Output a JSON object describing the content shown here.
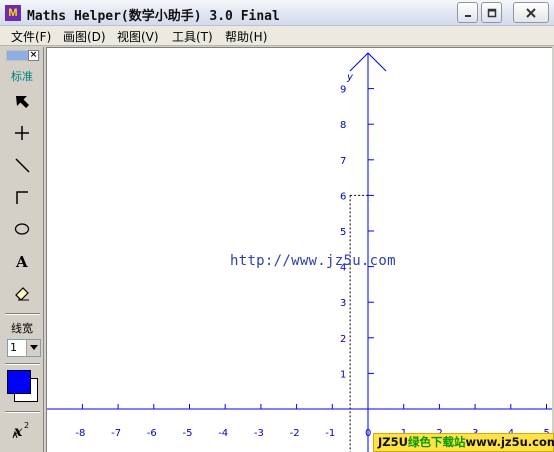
{
  "window": {
    "title": "Maths Helper(数学小助手) 3.0 Final",
    "icon_text": "M",
    "accent_color": "#6a2bb5"
  },
  "menu": {
    "items": [
      {
        "label": "文件(F)"
      },
      {
        "label": "画图(D)"
      },
      {
        "label": "视图(V)"
      },
      {
        "label": "工具(T)"
      },
      {
        "label": "帮助(H)"
      }
    ]
  },
  "toolbar": {
    "mode_label": "标准",
    "tools": [
      {
        "name": "select-arrow-icon"
      },
      {
        "name": "crosshair-point-icon"
      },
      {
        "name": "line-tool-icon"
      },
      {
        "name": "right-angle-icon"
      },
      {
        "name": "ellipse-tool-icon"
      },
      {
        "name": "text-tool-icon"
      },
      {
        "name": "eraser-icon"
      }
    ],
    "line_width_label": "线宽",
    "line_width_value": "1",
    "foreground_color": "#0000ff",
    "background_color": "#ffffff",
    "formula_icon": "function-x2-icon"
  },
  "graph": {
    "y_axis_label": "y",
    "x_ticks": [
      "-8",
      "-7",
      "-6",
      "-5",
      "-4",
      "-3",
      "-2",
      "-1",
      "0",
      "1",
      "2",
      "3",
      "4",
      "5"
    ],
    "y_ticks": [
      "1",
      "2",
      "3",
      "4",
      "5",
      "6",
      "7",
      "8",
      "9"
    ],
    "axis_color": "#0000ff",
    "marked_point": {
      "x": -0.5,
      "y": 6
    }
  },
  "watermark": {
    "text": "http://www.jz5u.com"
  },
  "badge": {
    "prefix": "JZ5U",
    "middle": "绿色下载站",
    "suffix": "www.jz5u.com"
  }
}
